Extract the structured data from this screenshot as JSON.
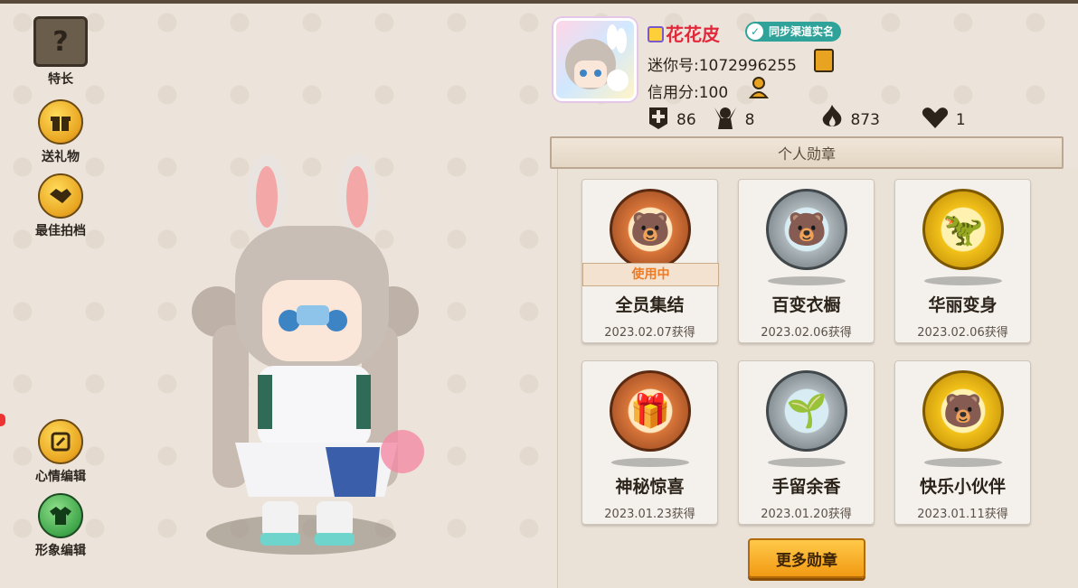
{
  "left_menu": {
    "specialty": {
      "label": "特长",
      "icon": "question-icon"
    },
    "gift": {
      "label": "送礼物",
      "icon": "gift-icon"
    },
    "partner": {
      "label": "最佳拍档",
      "icon": "handshake-icon"
    },
    "mood": {
      "label": "心情编辑",
      "icon": "edit-icon"
    },
    "appearance": {
      "label": "形象编辑",
      "icon": "outfit-icon"
    }
  },
  "profile": {
    "nickname": "花花皮",
    "sync_badge": "同步渠道实名",
    "uid_label": "迷你号:1072996255",
    "credit_label": "信用分:100",
    "stats": [
      {
        "icon": "add-friend-icon",
        "value": "86"
      },
      {
        "icon": "fans-icon",
        "value": "8"
      },
      {
        "icon": "flame-icon",
        "value": "873"
      },
      {
        "icon": "heart-icon",
        "value": "1"
      }
    ]
  },
  "medals": {
    "title": "个人勋章",
    "in_use_label": "使用中",
    "items": [
      {
        "name": "全员集结",
        "date": "2023.02.07获得",
        "tier": "bronze",
        "in_use": true
      },
      {
        "name": "百变衣橱",
        "date": "2023.02.06获得",
        "tier": "silver",
        "in_use": false
      },
      {
        "name": "华丽变身",
        "date": "2023.02.06获得",
        "tier": "gold",
        "in_use": false
      },
      {
        "name": "神秘惊喜",
        "date": "2023.01.23获得",
        "tier": "bronze",
        "in_use": false
      },
      {
        "name": "手留余香",
        "date": "2023.01.20获得",
        "tier": "silver",
        "in_use": false
      },
      {
        "name": "快乐小伙伴",
        "date": "2023.01.11获得",
        "tier": "gold",
        "in_use": false
      }
    ],
    "more_button": "更多勋章"
  }
}
